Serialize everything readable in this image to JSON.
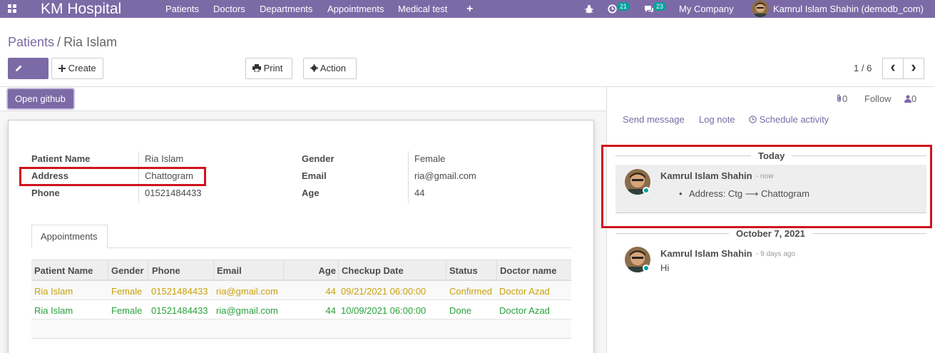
{
  "navbar": {
    "brand": "KM Hospital",
    "menu": [
      "Patients",
      "Doctors",
      "Departments",
      "Appointments",
      "Medical test"
    ],
    "add_icon": "+",
    "activity_count": "21",
    "message_count": "23",
    "company": "My Company",
    "user": "Kamrul Islam Shahin (demodb_com)"
  },
  "breadcrumb": {
    "parent": "Patients",
    "separator": "/",
    "current": "Ria Islam"
  },
  "toolbar": {
    "edit": "Edit",
    "create": "Create",
    "print": "Print",
    "action": "Action",
    "pager": "1 / 6",
    "prev": "‹",
    "next": "›"
  },
  "header_button": "Open github",
  "form": {
    "labels": {
      "patient_name": "Patient Name",
      "address": "Address",
      "phone": "Phone",
      "gender": "Gender",
      "email": "Email",
      "age": "Age"
    },
    "values": {
      "patient_name": "Ria Islam",
      "address": "Chattogram",
      "phone": "01521484433",
      "gender": "Female",
      "email": "ria@gmail.com",
      "age": "44"
    }
  },
  "tabs": [
    "Appointments"
  ],
  "appointments": {
    "columns": [
      "Patient Name",
      "Gender",
      "Phone",
      "Email",
      "Age",
      "Checkup Date",
      "Status",
      "Doctor name"
    ],
    "rows": [
      [
        "Ria Islam",
        "Female",
        "01521484433",
        "ria@gmail.com",
        "44",
        "09/21/2021 06:00:00",
        "Confirmed",
        "Doctor Azad"
      ],
      [
        "Ria Islam",
        "Female",
        "01521484433",
        "ria@gmail.com",
        "44",
        "10/09/2021 06:00:00",
        "Done",
        "Doctor Azad"
      ]
    ]
  },
  "chatter": {
    "attachments": "0",
    "follow": "Follow",
    "followers": "0",
    "send_message": "Send message",
    "log_note": "Log note",
    "schedule_activity": "Schedule activity",
    "groups": [
      {
        "date": "Today",
        "author": "Kamrul Islam Shahin",
        "ago": "- now",
        "body": "Address: Ctg ⟶ Chattogram"
      },
      {
        "date": "October 7, 2021",
        "author": "Kamrul Islam Shahin",
        "ago": "- 9 days ago",
        "body": "Hi"
      }
    ]
  },
  "colors": {
    "brand": "#7c6aa6",
    "highlight_red": "#d0121c",
    "confirmed": "#c9a10c",
    "done": "#28a03b",
    "online": "#00a09d"
  }
}
